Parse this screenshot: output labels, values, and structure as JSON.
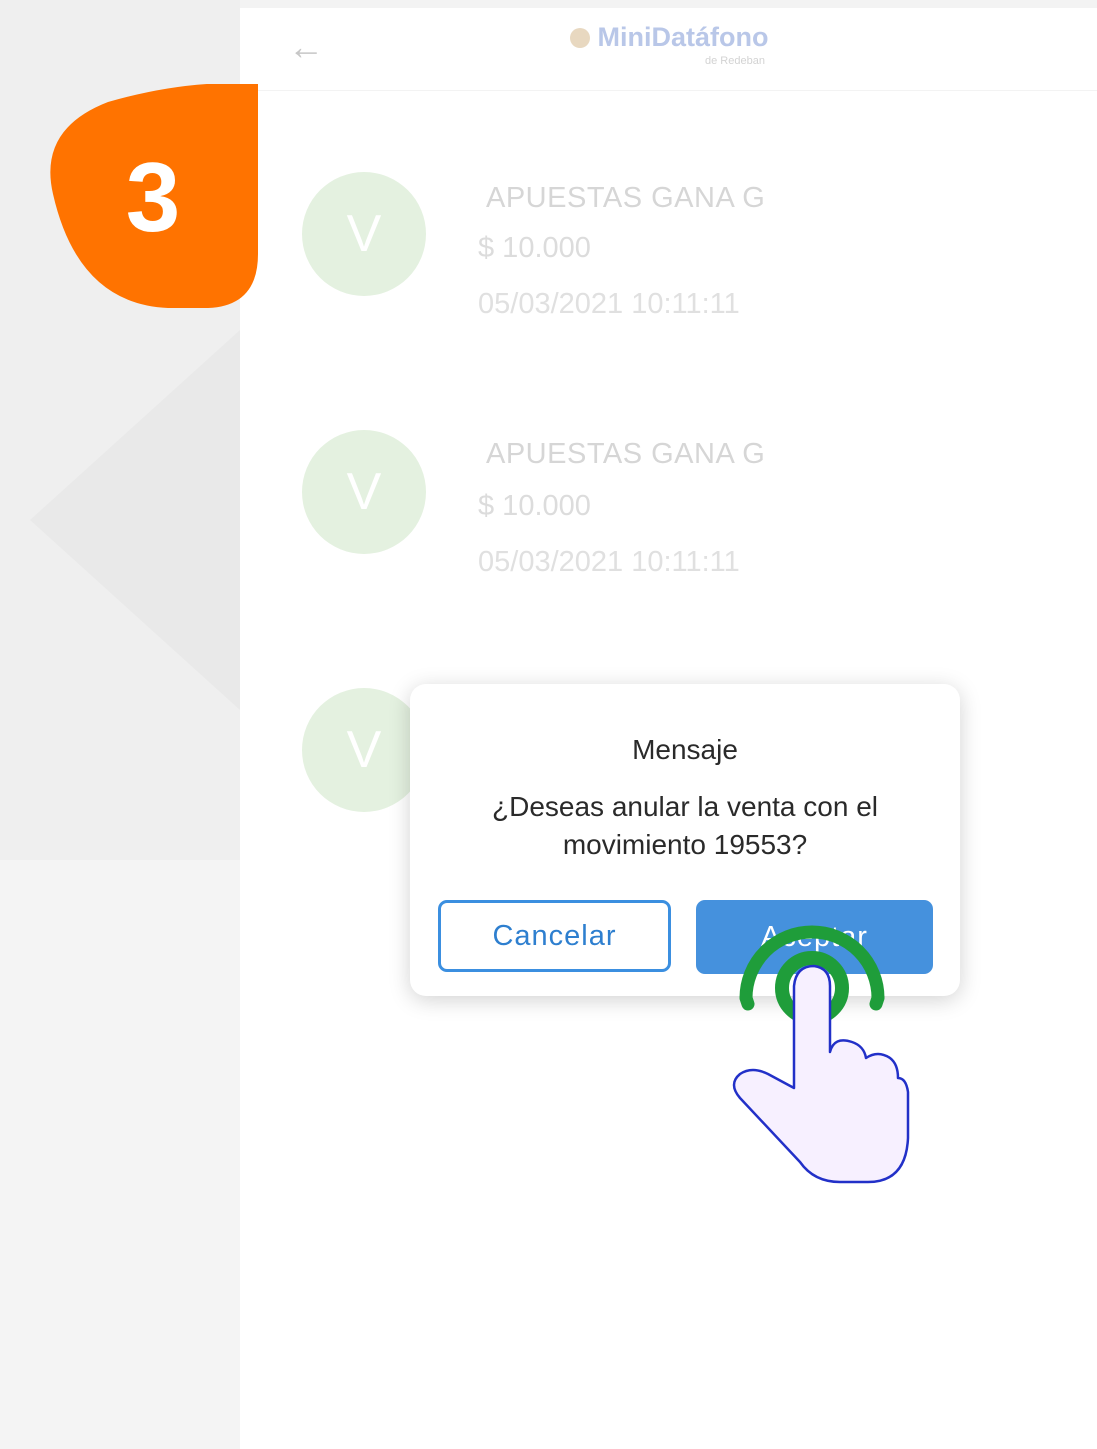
{
  "step": {
    "number": "3",
    "color": "#ff7300"
  },
  "header": {
    "back_icon": "←",
    "logo_text": "MiniDatáfono",
    "logo_subtext": "de Redeban"
  },
  "transactions": [
    {
      "avatar_letter": "V",
      "merchant": "APUESTAS GANA G",
      "amount": "$ 10.000",
      "datetime": "05/03/2021  10:11:11"
    },
    {
      "avatar_letter": "V",
      "merchant": "APUESTAS GANA G",
      "amount": "$ 10.000",
      "datetime": "05/03/2021  10:11:11"
    },
    {
      "avatar_letter": "V"
    }
  ],
  "dialog": {
    "title": "Mensaje",
    "message": "¿Deseas anular la venta con el movimiento 19553?",
    "cancel_label": "Cancelar",
    "accept_label": "Aceptar"
  },
  "gesture": {
    "icon": "tap-hand-icon",
    "ring_color": "#1f9d3a",
    "hand_outline_color": "#2230c8"
  },
  "colors": {
    "primary": "#4591dd",
    "avatar_bg": "#e4f1e0"
  }
}
